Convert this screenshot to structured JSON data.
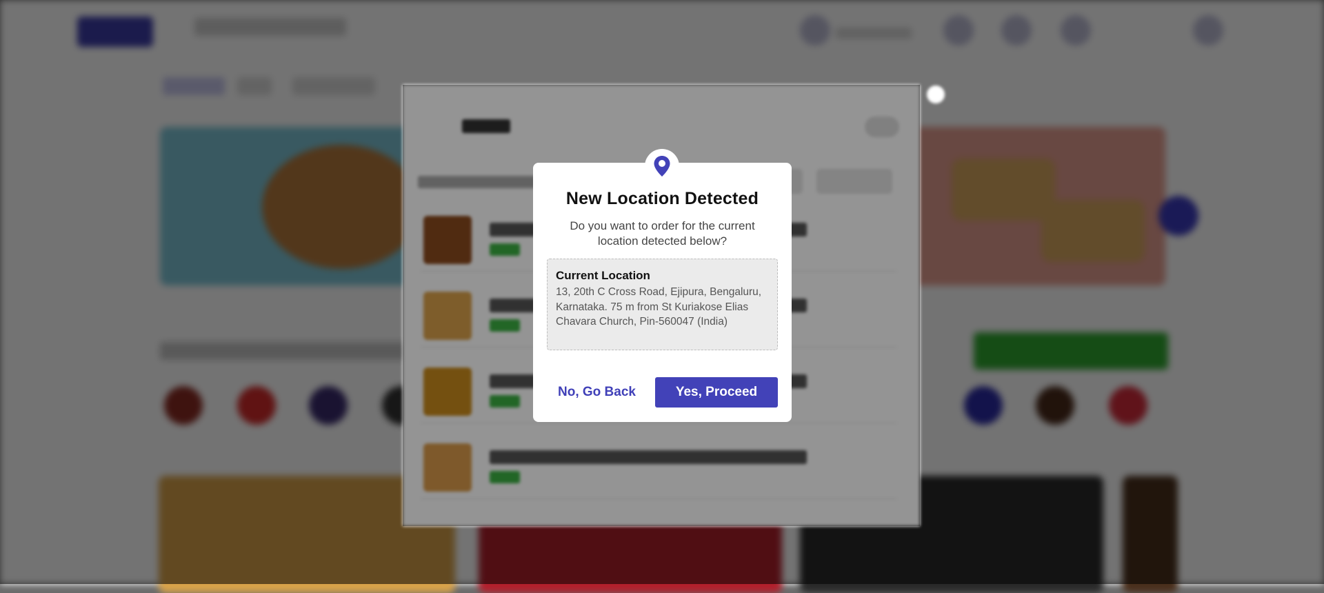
{
  "dialog": {
    "title": "New Location Detected",
    "question": "Do you want to order for the current location detected below?",
    "location_label": "Current Location",
    "location_address": "13, 20th C Cross Road, Ejipura, Bengaluru, Karnataka. 75 m from St Kuriakose Elias Chavara Church, Pin-560047 (India)",
    "back_label": "No, Go Back",
    "proceed_label": "Yes, Proceed",
    "icon": "location-pin-icon"
  },
  "colors": {
    "accent": "#4242b8",
    "overlay": "#000000",
    "location_box": "#ebebeb"
  }
}
